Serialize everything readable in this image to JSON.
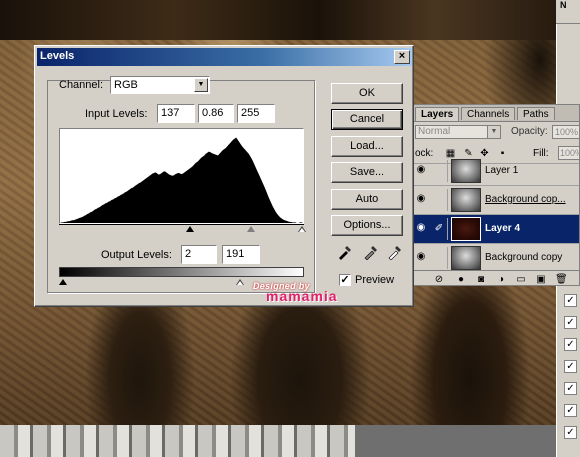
{
  "dialog": {
    "title": "Levels",
    "channel_label": "Channel:",
    "channel_value": "RGB",
    "input_levels_label": "Input Levels:",
    "input_black": "137",
    "input_gamma": "0.86",
    "input_white": "255",
    "output_levels_label": "Output Levels:",
    "output_black": "2",
    "output_white": "191",
    "buttons": {
      "ok": "OK",
      "cancel": "Cancel",
      "load": "Load...",
      "save": "Save...",
      "auto": "Auto",
      "options": "Options..."
    },
    "preview_label": "Preview",
    "preview_checked": true,
    "close_symbol": "×"
  },
  "histogram": [
    0,
    1,
    1,
    2,
    2,
    3,
    3,
    4,
    5,
    5,
    6,
    7,
    8,
    9,
    10,
    11,
    13,
    14,
    16,
    17,
    19,
    20,
    22,
    24,
    25,
    27,
    28,
    30,
    32,
    33,
    35,
    36,
    38,
    39,
    41,
    42,
    44,
    45,
    47,
    48,
    50,
    51,
    53,
    55,
    56,
    58,
    60,
    62,
    63,
    65,
    67,
    69,
    71,
    72,
    74,
    76,
    78,
    80,
    82,
    84,
    86,
    88,
    89,
    90,
    88,
    86,
    87,
    89,
    91,
    92,
    90,
    88,
    86,
    85,
    84,
    85,
    87,
    88,
    89,
    88,
    87,
    88,
    90,
    92,
    94,
    96,
    98,
    100,
    103,
    106,
    108,
    110,
    113,
    116,
    118,
    120,
    123,
    125,
    127,
    126,
    124,
    123,
    122,
    121,
    120,
    123,
    126,
    129,
    131,
    133,
    136,
    139,
    142,
    145,
    148,
    150,
    152,
    148,
    144,
    140,
    136,
    133,
    130,
    127,
    124,
    120,
    115,
    110,
    104,
    98,
    92,
    86,
    80,
    74,
    68,
    62,
    55,
    48,
    42,
    36,
    30,
    25,
    20,
    16,
    13,
    10,
    8,
    6,
    5,
    4,
    3,
    2,
    2,
    1,
    1,
    1,
    0,
    0,
    1,
    1,
    0
  ],
  "layers_panel": {
    "tabs": [
      "Layers",
      "Channels",
      "Paths"
    ],
    "blend_mode": "Normal",
    "opacity_label": "Opacity:",
    "opacity_value": "100%",
    "lock_label": "ock:",
    "fill_label": "Fill:",
    "fill_value": "100%",
    "layers": [
      {
        "name": "Layer 1",
        "selected": false
      },
      {
        "name": "Background cop...",
        "selected": false
      },
      {
        "name": "Layer 4",
        "selected": true
      },
      {
        "name": "Background copy",
        "selected": false
      }
    ]
  },
  "corner_panel_label": "N",
  "watermark": {
    "line1": "Designed by",
    "line2": "mamamia"
  }
}
